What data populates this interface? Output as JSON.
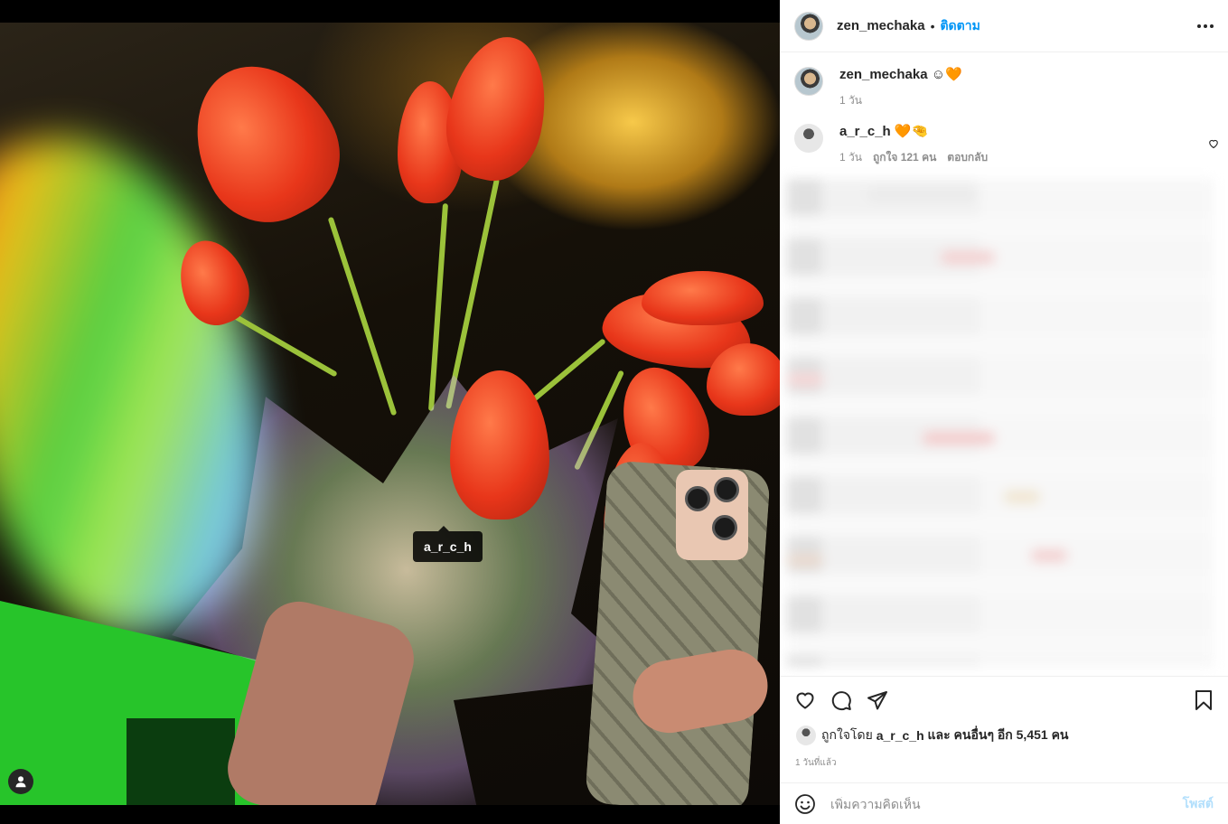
{
  "media": {
    "tag_label": "a_r_c_h",
    "user_tag_icon": "person-icon"
  },
  "header": {
    "username": "zen_mechaka",
    "separator": "•",
    "follow_label": "ติดตาม",
    "more_icon": "more-horizontal-icon"
  },
  "caption": {
    "username": "zen_mechaka",
    "text": "☺🧡",
    "time": "1 วัน"
  },
  "comments": [
    {
      "username": "a_r_c_h",
      "text": "🧡🤏",
      "time": "1 วัน",
      "likes": "ถูกใจ 121 คน",
      "reply_label": "ตอบกลับ"
    }
  ],
  "actions": {
    "like_icon": "heart-icon",
    "comment_icon": "comment-icon",
    "share_icon": "send-icon",
    "save_icon": "bookmark-icon"
  },
  "likes_summary": {
    "prefix": "ถูกใจโดย",
    "user": "a_r_c_h",
    "middle": "และ",
    "others": "คนอื่นๆ อีก 5,451 คน"
  },
  "timestamp": "1 วันที่แล้ว",
  "add_comment": {
    "placeholder": "เพิ่มความคิดเห็น",
    "post_label": "โพสต์",
    "emoji_icon": "emoji-icon"
  },
  "colors": {
    "link_blue": "#0095f6",
    "post_disabled": "#b2dffc",
    "heart_orange": "#ff6a00"
  }
}
